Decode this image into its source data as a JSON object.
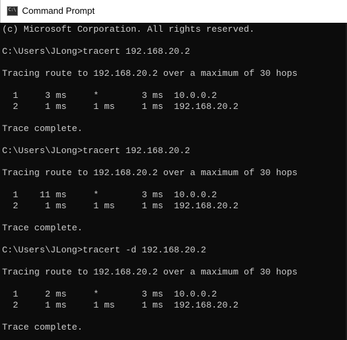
{
  "window": {
    "title": "Command Prompt",
    "icon": "cmd-icon",
    "icon_glyph": "C:\\"
  },
  "console": {
    "lines": [
      "(c) Microsoft Corporation. All rights reserved.",
      "",
      "C:\\Users\\JLong>tracert 192.168.20.2",
      "",
      "Tracing route to 192.168.20.2 over a maximum of 30 hops",
      "",
      "  1     3 ms     *        3 ms  10.0.0.2",
      "  2     1 ms     1 ms     1 ms  192.168.20.2",
      "",
      "Trace complete.",
      "",
      "C:\\Users\\JLong>tracert 192.168.20.2",
      "",
      "Tracing route to 192.168.20.2 over a maximum of 30 hops",
      "",
      "  1    11 ms     *        3 ms  10.0.0.2",
      "  2     1 ms     1 ms     1 ms  192.168.20.2",
      "",
      "Trace complete.",
      "",
      "C:\\Users\\JLong>tracert -d 192.168.20.2",
      "",
      "Tracing route to 192.168.20.2 over a maximum of 30 hops",
      "",
      "  1     2 ms     *        3 ms  10.0.0.2",
      "  2     1 ms     1 ms     1 ms  192.168.20.2",
      "",
      "Trace complete."
    ]
  },
  "colors": {
    "background": "#0c0c0c",
    "text": "#cccccc",
    "titlebar": "#ffffff"
  }
}
